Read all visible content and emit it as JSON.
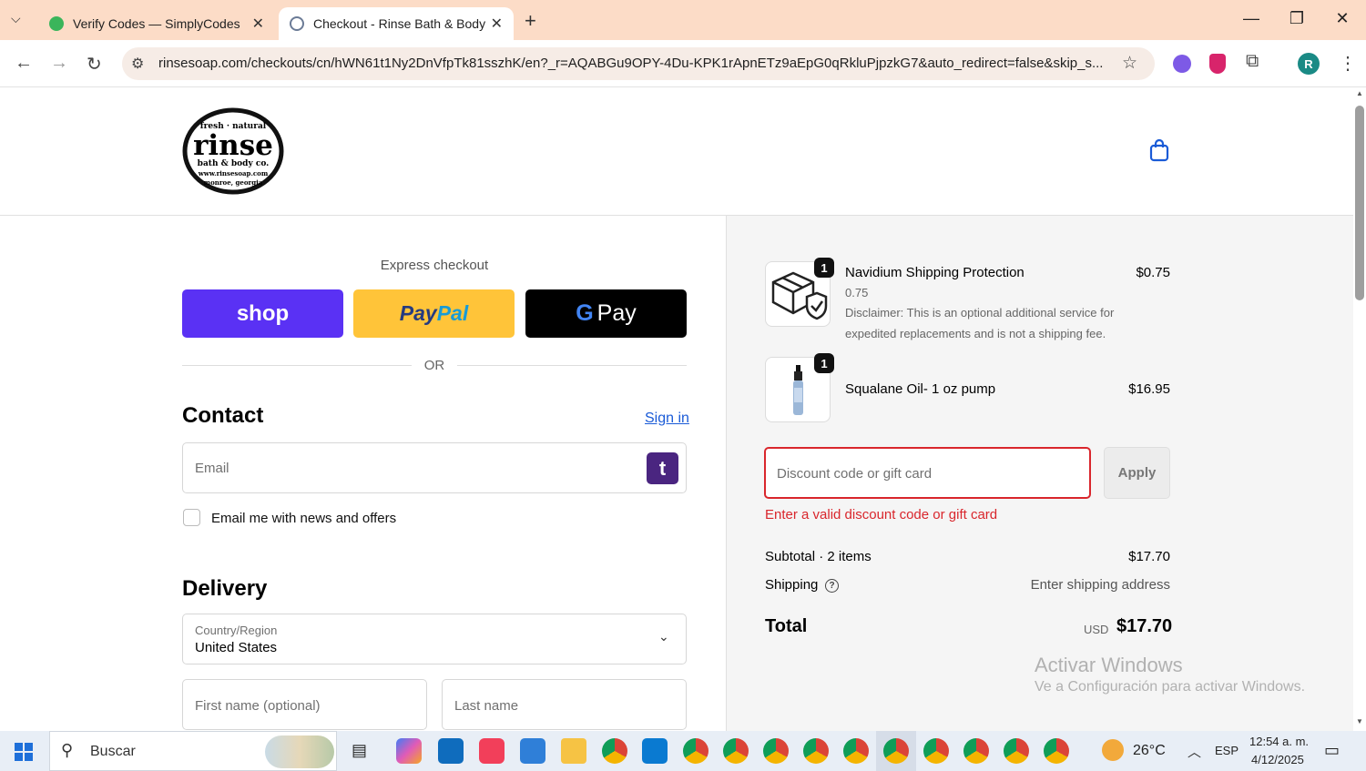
{
  "browser": {
    "tabs": [
      {
        "title": "Verify Codes — SimplyCodes"
      },
      {
        "title": "Checkout - Rinse Bath & Body"
      }
    ],
    "url": "rinsesoap.com/checkouts/cn/hWN61t1Ny2DnVfpTk81sszhK/en?_r=AQABGu9OPY-4Du-KPK1rApnETz9aEpG0qRkluPjpzkG7&auto_redirect=false&skip_s...",
    "profile_initial": "R"
  },
  "logo": {
    "top_text": "fresh · natural",
    "main": "rinse",
    "sub": "bath & body co.",
    "url": "www.rinsesoap.com",
    "bottom": "monroe, georgia"
  },
  "checkout": {
    "express_label": "Express checkout",
    "shop_label": "shop",
    "paypal_label_a": "Pay",
    "paypal_label_b": "Pal",
    "gpay_label": "Pay",
    "or_label": "OR",
    "contact_heading": "Contact",
    "sign_in": "Sign in",
    "email_placeholder": "Email",
    "email_news_label": "Email me with news and offers",
    "delivery_heading": "Delivery",
    "country_label": "Country/Region",
    "country_value": "United States",
    "first_name_placeholder": "First name (optional)",
    "last_name_placeholder": "Last name"
  },
  "summary": {
    "items": [
      {
        "qty": "1",
        "name": "Navidium Shipping Protection",
        "price": "$0.75",
        "variant": "0.75",
        "note_line1": "Disclaimer: This is an optional additional service for",
        "note_line2": "expedited replacements and is not a shipping fee."
      },
      {
        "qty": "1",
        "name": "Squalane Oil- 1 oz pump",
        "price": "$16.95"
      }
    ],
    "discount_placeholder": "Discount code or gift card",
    "apply_label": "Apply",
    "discount_error": "Enter a valid discount code or gift card",
    "subtotal_label": "Subtotal · 2 items",
    "subtotal_value": "$17.70",
    "shipping_label": "Shipping",
    "shipping_value": "Enter shipping address",
    "total_label": "Total",
    "currency": "USD",
    "total_value": "$17.70",
    "error_color": "#d9262c",
    "link_color": "#1a5bd7"
  },
  "watermark": {
    "line1": "Activar Windows",
    "line2": "Ve a Configuración para activar Windows."
  },
  "taskbar": {
    "search_label": "Buscar",
    "weather": "26°C",
    "lang": "ESP",
    "time": "12:54 a. m.",
    "date": "4/12/2025"
  }
}
